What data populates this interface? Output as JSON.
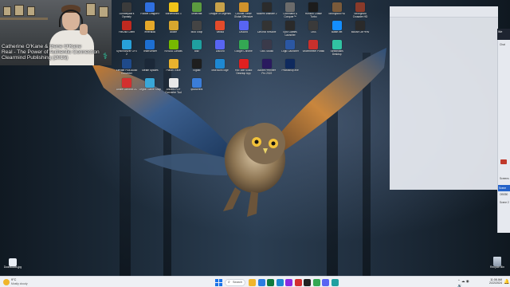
{
  "webcam": {
    "caption_lines": [
      "Catherine O'Kane & Gene O'Kane",
      "Real - The Power of Authentic Connection",
      "Clearmind Publishing (2015)"
    ]
  },
  "desktop_icons": [
    {
      "label": "Lumberjack's Dynasty",
      "color": "#3b3b3b"
    },
    {
      "label": "Rocket League®",
      "color": "#2f6fe0"
    },
    {
      "label": "Borderlands 3",
      "color": "#f0c419"
    },
    {
      "label": "Minecraft",
      "color": "#5b9b3f"
    },
    {
      "label": "League of Legends",
      "color": "#c8a24a"
    },
    {
      "label": "Counter-Strike Global Offensive",
      "color": "#d0922b"
    },
    {
      "label": "Modern Warfare 2",
      "color": "#2b2b2b"
    },
    {
      "label": "Command & Conquer™",
      "color": "#6b6b6b"
    },
    {
      "label": "Horizon Chase Turbo",
      "color": "#1c1c1c"
    },
    {
      "label": "Stronghold HD",
      "color": "#7a5a3a"
    },
    {
      "label": "Stronghold Crusader HD",
      "color": "#8a3a2a"
    },
    {
      "label": "FileZilla Client",
      "color": "#bf2a20"
    },
    {
      "label": "emeraldB",
      "color": "#e5a82a"
    },
    {
      "label": "adobe",
      "color": "#d7a62e"
    },
    {
      "label": "Mod Shop",
      "color": "#444"
    },
    {
      "label": "Vanilla",
      "color": "#e34b2b"
    },
    {
      "label": "Discord",
      "color": "#5865f2"
    },
    {
      "label": "DaVinci Resolve",
      "color": "#333"
    },
    {
      "label": "Epic Games Launcher",
      "color": "#2a2a2a"
    },
    {
      "label": "OBS",
      "color": "#3a3a3a"
    },
    {
      "label": "Battle.net",
      "color": "#148eff"
    },
    {
      "label": "Mouse Ctrl+env",
      "color": "#2a2a2a"
    },
    {
      "label": "Synchronizer GFX 2",
      "color": "#28a0d8"
    },
    {
      "label": "TeamViewer",
      "color": "#1d6fd1"
    },
    {
      "label": "NVIDIA Canvas",
      "color": "#76b900"
    },
    {
      "label": "Blitz",
      "color": "#1fa0a0"
    },
    {
      "label": "Discord",
      "color": "#5865f2"
    },
    {
      "label": "Google Chrome",
      "color": "#34a853"
    },
    {
      "label": "OBS Studio",
      "color": "#3a3a4a"
    },
    {
      "label": "Logic Launcher",
      "color": "#2b57a3"
    },
    {
      "label": "Voicemeeter Potato",
      "color": "#c9302c"
    },
    {
      "label": "Streamlabs Desktop",
      "color": "#31c3a2"
    },
    {
      "label": "Elevate Plus Audio Converter",
      "color": "#1f4a8a"
    },
    {
      "label": "Steam Spaces",
      "color": "#1b2838"
    },
    {
      "label": "Piarah Trace",
      "color": "#e9b22e"
    },
    {
      "label": "Elgato",
      "color": "#1e1e1e"
    },
    {
      "label": "Microsoft Edge",
      "color": "#1e88d2"
    },
    {
      "label": "YouTube Music Desktop App",
      "color": "#e02020"
    },
    {
      "label": "Adobe Premiere Pro 2022",
      "color": "#2a1a5e"
    },
    {
      "label": "Photoshop.exe",
      "color": "#0f2a5e"
    },
    {
      "label": "Adobe Acrobat DC",
      "color": "#d32f2f"
    },
    {
      "label": "Legion Game Shop",
      "color": "#39a7d8"
    },
    {
      "label": "Ancient PDF Converter Tool",
      "color": "#e8e8e8"
    },
    {
      "label": "qBittorrent",
      "color": "#3b7dd8"
    }
  ],
  "right_panel": {
    "header": "We",
    "items": [
      "Chat",
      "Screens",
      "Scene",
      "OBS50",
      "Scene 2"
    ],
    "active_item": "Scene"
  },
  "recycle_bin": {
    "label": "Recycle Bin"
  },
  "bottom_left_icon": {
    "label": "Downloads.jpg"
  },
  "taskbar": {
    "weather_temp": "9°C",
    "weather_cond": "Mostly cloudy",
    "search_label": "Search",
    "time": "11:08 AM",
    "date": "2/22/2024",
    "pinned_colors": [
      "#f0b52b",
      "#2a7de1",
      "#0f7a3e",
      "#1e88d2",
      "#8a2be2",
      "#d32f2f",
      "#222",
      "#34a853",
      "#5865f2",
      "#1fa0a0"
    ]
  }
}
